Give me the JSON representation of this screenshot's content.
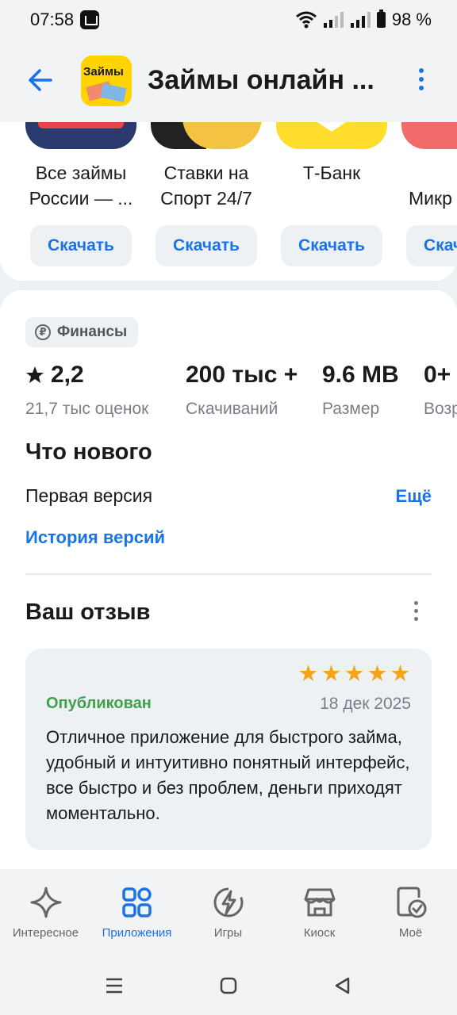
{
  "status_bar": {
    "time": "07:58",
    "battery": "98 %"
  },
  "header": {
    "title": "Займы онлайн ...",
    "logo_text": "Займы"
  },
  "carousel": [
    {
      "name": "Все займы России — ...",
      "button": "Скачать",
      "color": "#2a3a6e"
    },
    {
      "name": "Ставки на Спорт 24/7",
      "button": "Скачать",
      "color": "#f5c342"
    },
    {
      "name": "Т-Банк",
      "button": "Скачать",
      "color": "#ffdd2d"
    },
    {
      "name": "Микр",
      "button": "Скачать",
      "color": "#f26b6b"
    }
  ],
  "category": "Финансы",
  "stats": [
    {
      "value": "2,2",
      "label": "21,7 тыс оценок"
    },
    {
      "value": "200 тыс +",
      "label": "Скачиваний"
    },
    {
      "value": "9.6 MB",
      "label": "Размер"
    },
    {
      "value": "0+",
      "label": "Возр"
    }
  ],
  "whats_new": {
    "heading": "Что нового",
    "text": "Первая версия",
    "more": "Ещё",
    "history": "История версий"
  },
  "review": {
    "heading": "Ваш отзыв",
    "status": "Опубликован",
    "date": "18 дек 2025",
    "stars": 5,
    "text": "Отличное приложение  для  быстрого займа, удобный и интуитивно понятный интерфейс, все быстро и без проблем, деньги приходят моментально."
  },
  "bottom_nav": [
    {
      "label": "Интересное",
      "icon": "sparkle-icon"
    },
    {
      "label": "Приложения",
      "icon": "apps-icon",
      "active": true
    },
    {
      "label": "Игры",
      "icon": "bolt-icon"
    },
    {
      "label": "Киоск",
      "icon": "kiosk-icon"
    },
    {
      "label": "Моё",
      "icon": "my-apps-icon"
    }
  ],
  "colors": {
    "accent": "#1a73e8",
    "published": "#3ea24a",
    "star": "#f4a31b"
  }
}
